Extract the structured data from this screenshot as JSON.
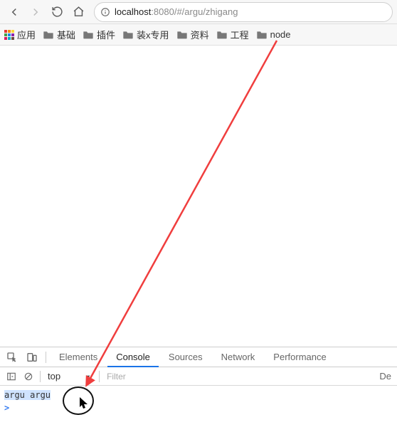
{
  "toolbar": {
    "url_host": "localhost",
    "url_rest": ":8080/#/argu/zhigang"
  },
  "bookmarks": {
    "apps_label": "应用",
    "items": [
      "基础",
      "插件",
      "装x专用",
      "资料",
      "工程",
      "node"
    ]
  },
  "devtools": {
    "tabs": [
      "Elements",
      "Console",
      "Sources",
      "Network",
      "Performance"
    ],
    "active_tab": "Console",
    "context_label": "top",
    "filter_placeholder": "Filter",
    "default_label": "De"
  },
  "console": {
    "output": "argu argu",
    "prompt": ">"
  }
}
